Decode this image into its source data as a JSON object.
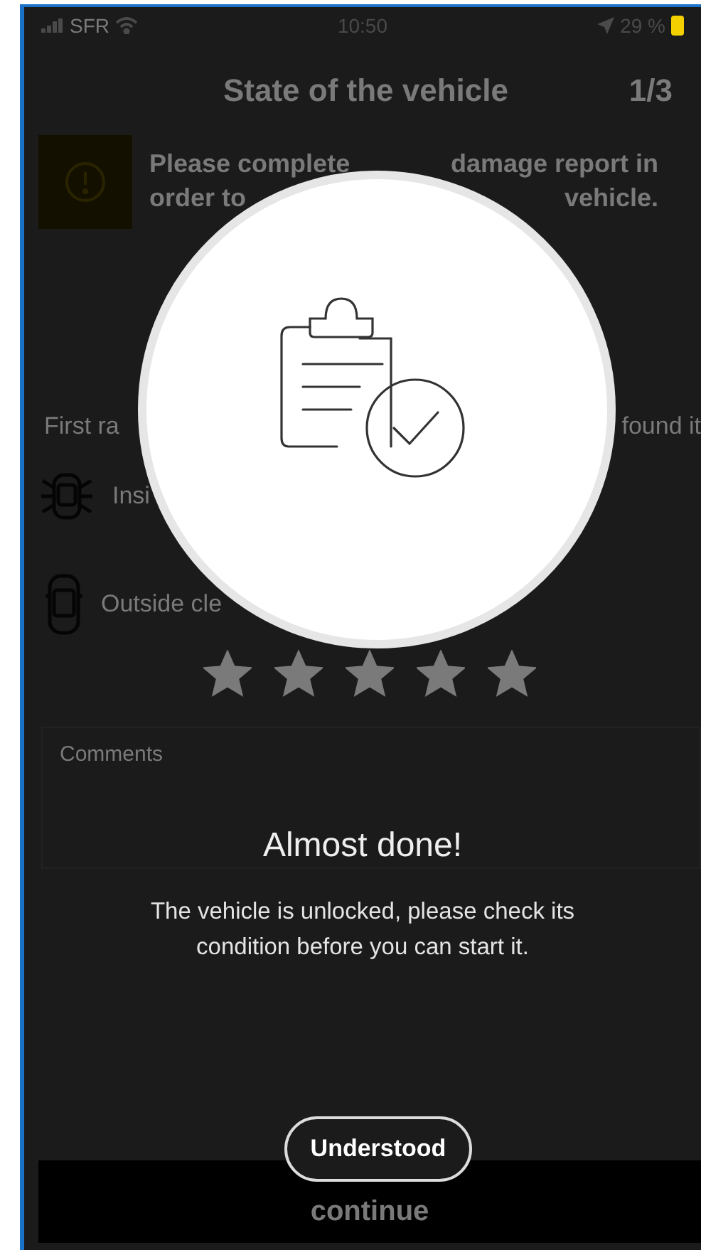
{
  "status_bar": {
    "carrier": "SFR",
    "time": "10:50",
    "battery": "29 %"
  },
  "header": {
    "title": "State of the vehicle",
    "step": "1/3"
  },
  "notice": {
    "lines": [
      {
        "left": "Please complete",
        "right": "damage report in"
      },
      {
        "left": "order to",
        "right": "vehicle."
      }
    ]
  },
  "rating": {
    "left": "First ra",
    "right": "found it"
  },
  "criteria": [
    {
      "kind": "inside",
      "label": "Insi"
    },
    {
      "kind": "outside",
      "label": "Outside cle"
    }
  ],
  "stars_row": {
    "stars": 5
  },
  "comments": {
    "placeholder": "Comments"
  },
  "footer": {
    "button": "continue"
  },
  "dialog": {
    "title": "Almost done!",
    "message": "The vehicle is unlocked, please check its condition before you can start it.",
    "button": "Understood"
  }
}
